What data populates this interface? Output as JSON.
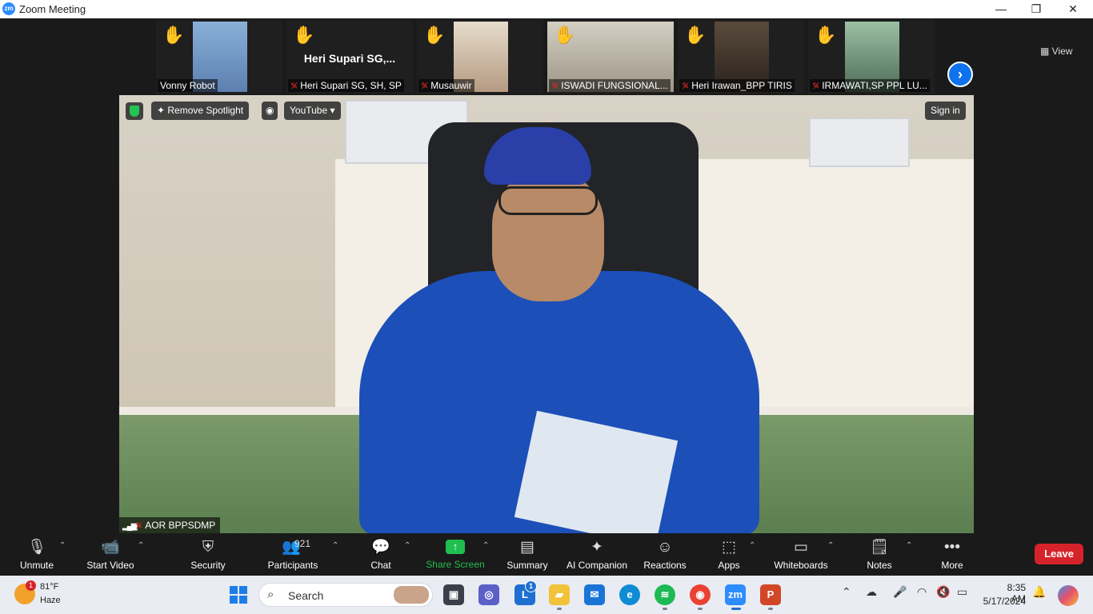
{
  "window": {
    "title": "Zoom Meeting",
    "logo": "zm",
    "controls": {
      "minimize": "—",
      "restore": "❐",
      "close": "✕"
    }
  },
  "participants_strip": {
    "tiles": [
      {
        "name": "Vonny Robot",
        "mic_muted": false,
        "hand_raised": true,
        "has_video": true
      },
      {
        "name": "Heri Supari SG, SH, SP",
        "display_name": "Heri Supari SG,...",
        "mic_muted": true,
        "hand_raised": true,
        "has_video": false
      },
      {
        "name": "Musauwir",
        "mic_muted": true,
        "hand_raised": true,
        "has_video": true
      },
      {
        "name": "ISWADI FUNGSIONAL...",
        "mic_muted": true,
        "hand_raised": true,
        "has_video": true
      },
      {
        "name": "Heri Irawan_BPP TIRIS",
        "mic_muted": true,
        "hand_raised": true,
        "has_video": true
      },
      {
        "name": "IRMAWATI,SP PPL LU...",
        "mic_muted": true,
        "hand_raised": true,
        "has_video": true
      }
    ],
    "next_icon": "chevron-right-icon",
    "view_label": "View"
  },
  "stage": {
    "remove_spotlight_label": "Remove Spotlight",
    "youtube_label": "YouTube",
    "sign_in_label": "Sign in",
    "speaker_name": "AOR BPPSDMP"
  },
  "toolbar": {
    "unmute": "Unmute",
    "start_video": "Start Video",
    "security": "Security",
    "participants": "Participants",
    "participants_count": "921",
    "chat": "Chat",
    "share_screen": "Share Screen",
    "summary": "Summary",
    "ai_companion": "AI Companion",
    "reactions": "Reactions",
    "apps": "Apps",
    "whiteboards": "Whiteboards",
    "notes": "Notes",
    "more": "More",
    "leave": "Leave",
    "accent": "#1fbf4f",
    "leave_color": "#d6232a"
  },
  "taskbar": {
    "weather_temp": "81°F",
    "weather_condition": "Haze",
    "weather_badge": "1",
    "search_label": "Search",
    "lync_badge": "1",
    "time": "8:35 AM",
    "date": "5/17/2024"
  }
}
